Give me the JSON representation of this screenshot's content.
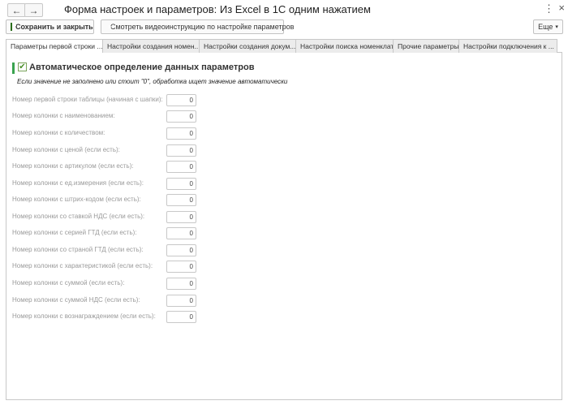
{
  "window": {
    "title": "Форма настроек и параметров: Из Excel в 1С одним нажатием",
    "back_icon": "←",
    "forward_icon": "→",
    "menu_icon": "⋮",
    "close_icon": "×"
  },
  "toolbar": {
    "save_close_label": "Сохранить и закрыть",
    "video_label": "Смотреть видеоинструкцию по настройке параметров",
    "more_label": "Еще",
    "more_caret": "▾"
  },
  "tabs": [
    {
      "label": "Параметры первой строки ...",
      "active": true
    },
    {
      "label": "Настройки создания номен...",
      "active": false
    },
    {
      "label": "Настройки создания докум...",
      "active": false
    },
    {
      "label": "Настройки поиска номенклат...",
      "active": false
    },
    {
      "label": "Прочие параметры",
      "active": false
    },
    {
      "label": "Настройки подключения к ...",
      "active": false
    }
  ],
  "group": {
    "checked": true,
    "check_mark": "✔",
    "title": "Автоматическое определение данных параметров",
    "hint": "Если значение не заполнено или стоит \"0\",  обработка ищет значение автоматически"
  },
  "fields": [
    {
      "label": "Номер первой строки таблицы (начиная с шапки):",
      "value": "0"
    },
    {
      "label": "Номер колонки с наименованием:",
      "value": "0"
    },
    {
      "label": "Номер колонки с количеством:",
      "value": "0"
    },
    {
      "label": "Номер колонки с ценой (если есть):",
      "value": "0"
    },
    {
      "label": "Номер колонки с артикулом (если есть):",
      "value": "0"
    },
    {
      "label": "Номер колонки с ед.измерения (если есть):",
      "value": "0"
    },
    {
      "label": "Номер колонки с штрих-кодом (если есть):",
      "value": "0"
    },
    {
      "label": "Номер колонки со ставкой НДС (если есть):",
      "value": "0"
    },
    {
      "label": "Номер колонки с серией ГТД (если есть):",
      "value": "0"
    },
    {
      "label": "Номер колонки со страной ГТД (если есть):",
      "value": "0"
    },
    {
      "label": "Номер колонки с характеристикой (если есть):",
      "value": "0"
    },
    {
      "label": "Номер колонки с суммой (если есть):",
      "value": "0"
    },
    {
      "label": "Номер колонки с суммой НДС (если есть):",
      "value": "0"
    },
    {
      "label": "Номер колонки с вознаграждением (если есть):",
      "value": "0"
    }
  ]
}
